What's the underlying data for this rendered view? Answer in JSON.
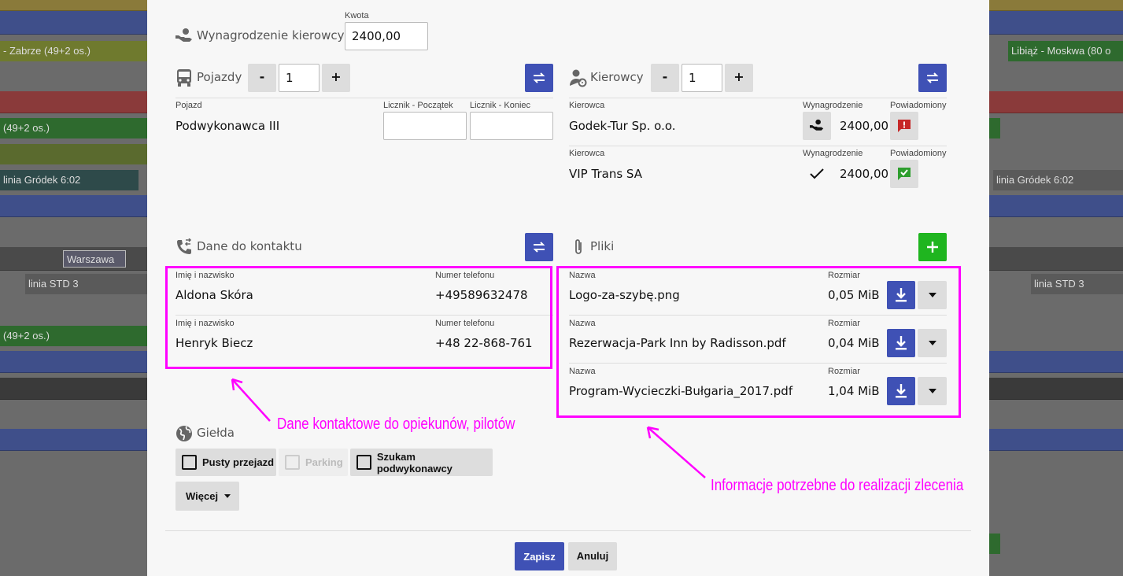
{
  "background": {
    "chips": [
      {
        "text": "- Zabrze (49+2 os.)"
      },
      {
        "text": "Libiąż - Moskwa (80 o"
      },
      {
        "text": "(49+2 os.)"
      },
      {
        "text": "linia Gródek 6:02"
      },
      {
        "text": "linia Gródek 6:02"
      },
      {
        "text": "Warszawa"
      },
      {
        "text": "linia STD 3"
      },
      {
        "text": "linia STD 3"
      },
      {
        "text": "(49+2 os.)"
      }
    ]
  },
  "driver_pay": {
    "label": "Wynagrodzenie kierowcy",
    "amount_label": "Kwota",
    "amount_value": "2400,00"
  },
  "vehicles": {
    "title": "Pojazdy",
    "minus": "-",
    "plus": "+",
    "count": "1",
    "col_vehicle": "Pojazd",
    "col_start": "Licznik - Początek",
    "col_end": "Licznik - Koniec",
    "rows": [
      {
        "vehicle": "Podwykonawca III",
        "start": "",
        "end": ""
      }
    ]
  },
  "drivers": {
    "title": "Kierowcy",
    "minus": "-",
    "plus": "+",
    "count": "1",
    "col_driver": "Kierowca",
    "col_pay": "Wynagrodzenie",
    "col_notified": "Powiadomiony",
    "rows": [
      {
        "name": "Godek-Tur Sp. o.o.",
        "pay": "2400,00",
        "notified": false
      },
      {
        "name": "VIP Trans SA",
        "pay": "2400,00",
        "notified": true
      }
    ]
  },
  "contacts": {
    "title": "Dane do kontaktu",
    "col_name": "Imię i nazwisko",
    "col_phone": "Numer telefonu",
    "rows": [
      {
        "name": "Aldona Skóra",
        "phone": "+49589632478"
      },
      {
        "name": "Henryk Biecz",
        "phone": "+48 22-868-761"
      }
    ]
  },
  "files": {
    "title": "Pliki",
    "col_name": "Nazwa",
    "col_size": "Rozmiar",
    "rows": [
      {
        "name": "Logo-za-szybę.png",
        "size": "0,05 MiB"
      },
      {
        "name": "Rezerwacja-Park Inn by Radisson.pdf",
        "size": "0,04 MiB"
      },
      {
        "name": "Program-Wycieczki-Bułgaria_2017.pdf",
        "size": "1,04 MiB"
      }
    ]
  },
  "exchange": {
    "title": "Giełda",
    "options": [
      {
        "label": "Pusty przejazd",
        "checked": false,
        "disabled": false
      },
      {
        "label": "Parking",
        "checked": false,
        "disabled": true
      },
      {
        "label": "Szukam podwykonawcy",
        "checked": false,
        "disabled": false
      }
    ],
    "more": "Więcej"
  },
  "footer": {
    "save": "Zapisz",
    "cancel": "Anuluj"
  },
  "annotations": {
    "contacts_note": "Dane kontaktowe do opiekunów, pilotów",
    "files_note": "Informacje potrzebne do realizacji zlecenia"
  },
  "colors": {
    "primary": "#3f51b5",
    "success": "#1fb51f",
    "danger": "#c62828",
    "annotation": "#ff00ff"
  }
}
